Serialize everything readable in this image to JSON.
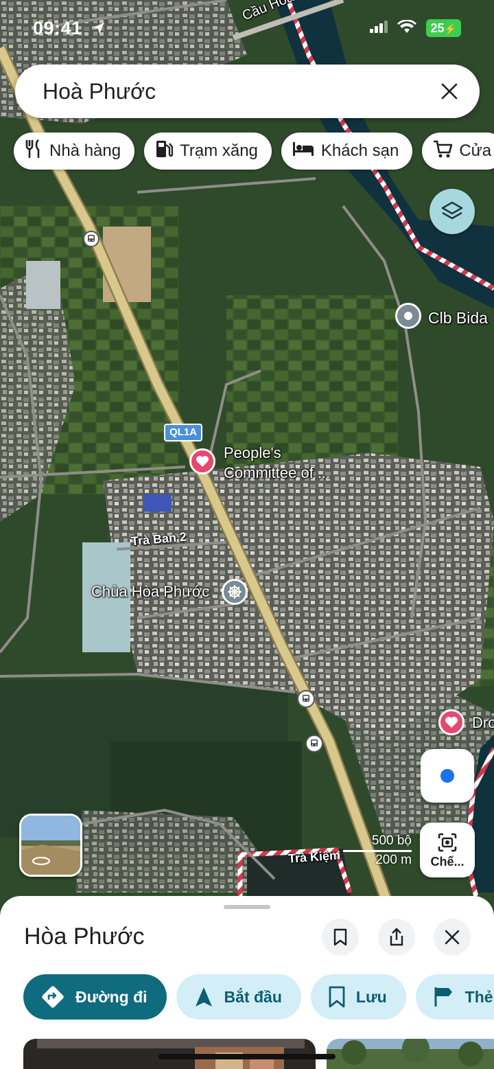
{
  "status_bar": {
    "time": "09:41",
    "battery": "25"
  },
  "search": {
    "query": "Hoà Phước"
  },
  "chips": [
    {
      "label": "Nhà hàng",
      "icon": "restaurant-icon"
    },
    {
      "label": "Trạm xăng",
      "icon": "gas-station-icon"
    },
    {
      "label": "Khách sạn",
      "icon": "hotel-icon"
    },
    {
      "label": "Cửa",
      "icon": "cart-icon"
    }
  ],
  "map": {
    "labels": {
      "bridge": "Cầu Hòa Phư",
      "bida": "Clb Bida",
      "route": "QL1A",
      "committee_line1": "People's",
      "committee_line2": "Committee of ...",
      "street_tra_ban": "Trà Ban 2",
      "temple": "Chùa Hòa Phước",
      "dro": "Dro",
      "street_tra_kiem": "Trà Kiệm"
    },
    "scale": {
      "upper": "500 bộ",
      "lower": "200 m"
    },
    "lens_label": "Chế...",
    "colors": {
      "water": "#10323f",
      "road_highway": "#d8c88b",
      "boundary": "#d9354a",
      "poi_heart": "#e8476e"
    }
  },
  "sheet": {
    "title": "Hòa Phước",
    "actions": [
      {
        "label": "Đường đi",
        "icon": "directions-icon"
      },
      {
        "label": "Bắt đầu",
        "icon": "navigation-arrow-icon"
      },
      {
        "label": "Lưu",
        "icon": "bookmark-icon"
      },
      {
        "label": "Thẻ",
        "icon": "flag-icon"
      }
    ]
  }
}
